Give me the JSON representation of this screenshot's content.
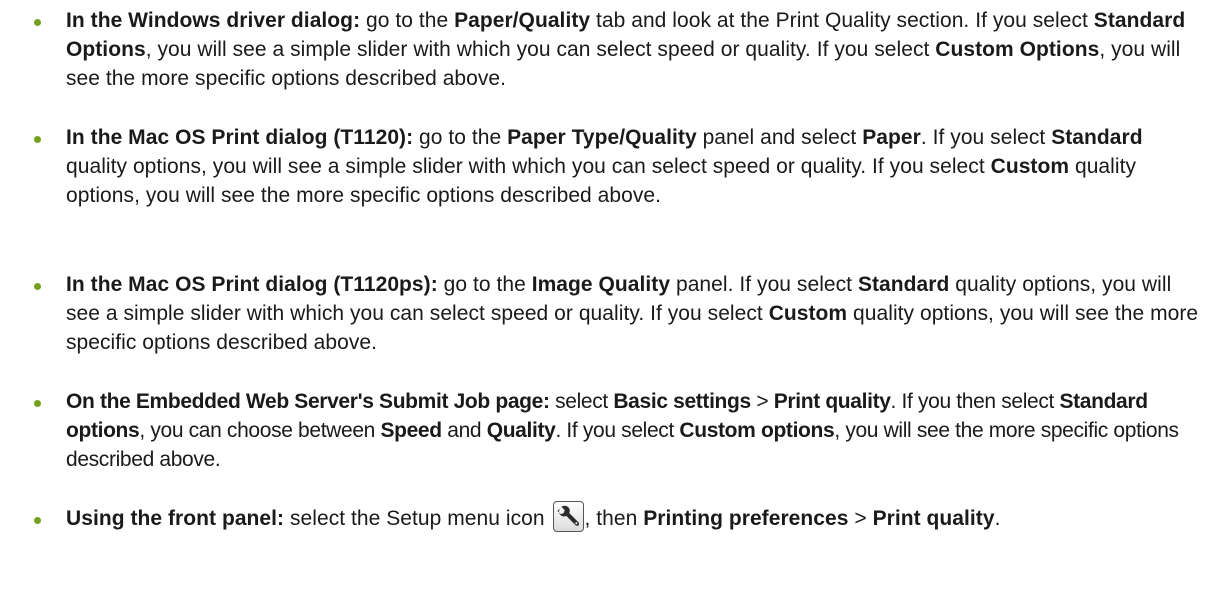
{
  "items": [
    {
      "lead": "In the Windows driver dialog:",
      "t1": " go to the ",
      "b1": "Paper/Quality",
      "t2": " tab and look at the Print Quality section. If you select ",
      "b2": "Standard Options",
      "t3": ", you will see a simple slider with which you can select speed or quality. If you select ",
      "b3": "Custom Options",
      "t4": ", you will see the more specific options described above."
    },
    {
      "lead": "In the Mac OS Print dialog (T1120):",
      "t1": " go to the ",
      "b1": "Paper Type/Quality",
      "t2": " panel and select ",
      "b2": "Paper",
      "t3": ". If you select ",
      "b3": "Standard",
      "t4": " quality options, you will see a simple slider with which you can select speed or quality. If you select ",
      "b4": "Custom",
      "t5": " quality options, you will see the more specific options described above."
    },
    {
      "lead": "In the Mac OS Print dialog (T1120ps):",
      "t1": " go to the ",
      "b1": "Image Quality",
      "t2": " panel. If you select ",
      "b2": "Standard",
      "t3": " quality options, you will see a simple slider with which you can select speed or quality. If you select ",
      "b3": "Custom",
      "t4": " quality options, you will see the more specific options described above."
    },
    {
      "lead": "On the Embedded Web Server's Submit Job page:",
      "t1": " select ",
      "b1": "Basic settings",
      "t2": " > ",
      "b2": "Print quality",
      "t3": ". If you then select ",
      "b3": "Standard options",
      "t4": ", you can choose between ",
      "b4": "Speed",
      "t5": " and ",
      "b5": "Quality",
      "t6": ". If you select ",
      "b6": "Custom options",
      "t7": ", you will see the more specific options described above."
    },
    {
      "lead": "Using the front panel:",
      "t1": " select the Setup menu icon ",
      "icon": "setup-wrench-icon",
      "t2": ", then ",
      "b1": "Printing preferences",
      "t3": " > ",
      "b2": "Print quality",
      "t4": "."
    }
  ],
  "colors": {
    "bullet": "#73a11f",
    "text": "#1a1a1a"
  }
}
